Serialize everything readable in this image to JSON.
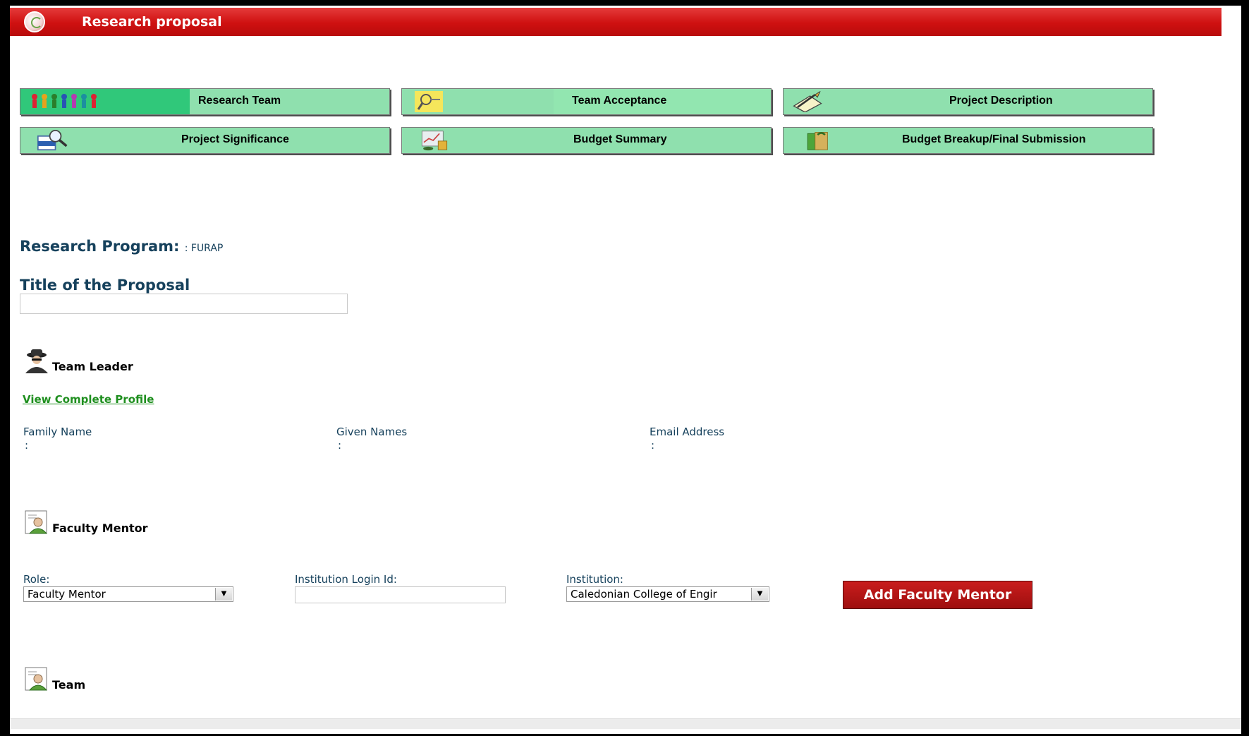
{
  "header": {
    "title": "Research proposal"
  },
  "nav": [
    {
      "label": "Research Team",
      "icon": "team-icon"
    },
    {
      "label": "Team Acceptance",
      "icon": "magnifier-key-icon"
    },
    {
      "label": "Project Description",
      "icon": "pencil-paper-icon"
    },
    {
      "label": "Project Significance",
      "icon": "search-document-icon"
    },
    {
      "label": "Budget Summary",
      "icon": "chart-money-icon"
    },
    {
      "label": "Budget Breakup/Final Submission",
      "icon": "money-bag-icon"
    }
  ],
  "program": {
    "label": "Research Program:",
    "value": ": FURAP"
  },
  "proposal": {
    "title_label": "Title of the Proposal",
    "title_value": ""
  },
  "team_leader": {
    "heading": "Team Leader",
    "profile_link": "View Complete Profile",
    "fields": [
      {
        "label": "Family Name",
        "value": ":"
      },
      {
        "label": "Given Names",
        "value": ":"
      },
      {
        "label": "Email Address",
        "value": ":"
      }
    ]
  },
  "faculty_mentor": {
    "heading": "Faculty Mentor",
    "role_label": "Role:",
    "role_value": "Faculty Mentor",
    "login_label": "Institution Login Id:",
    "login_value": "",
    "institution_label": "Institution:",
    "institution_value": "Caledonian College of Engir",
    "add_button": "Add Faculty Mentor"
  },
  "team": {
    "heading": "Team"
  },
  "colors": {
    "header_red": "#d11515",
    "nav_green": "#8fe0ae",
    "heading_blue": "#16415c",
    "link_green": "#1f8f1f",
    "button_red": "#b31515"
  }
}
